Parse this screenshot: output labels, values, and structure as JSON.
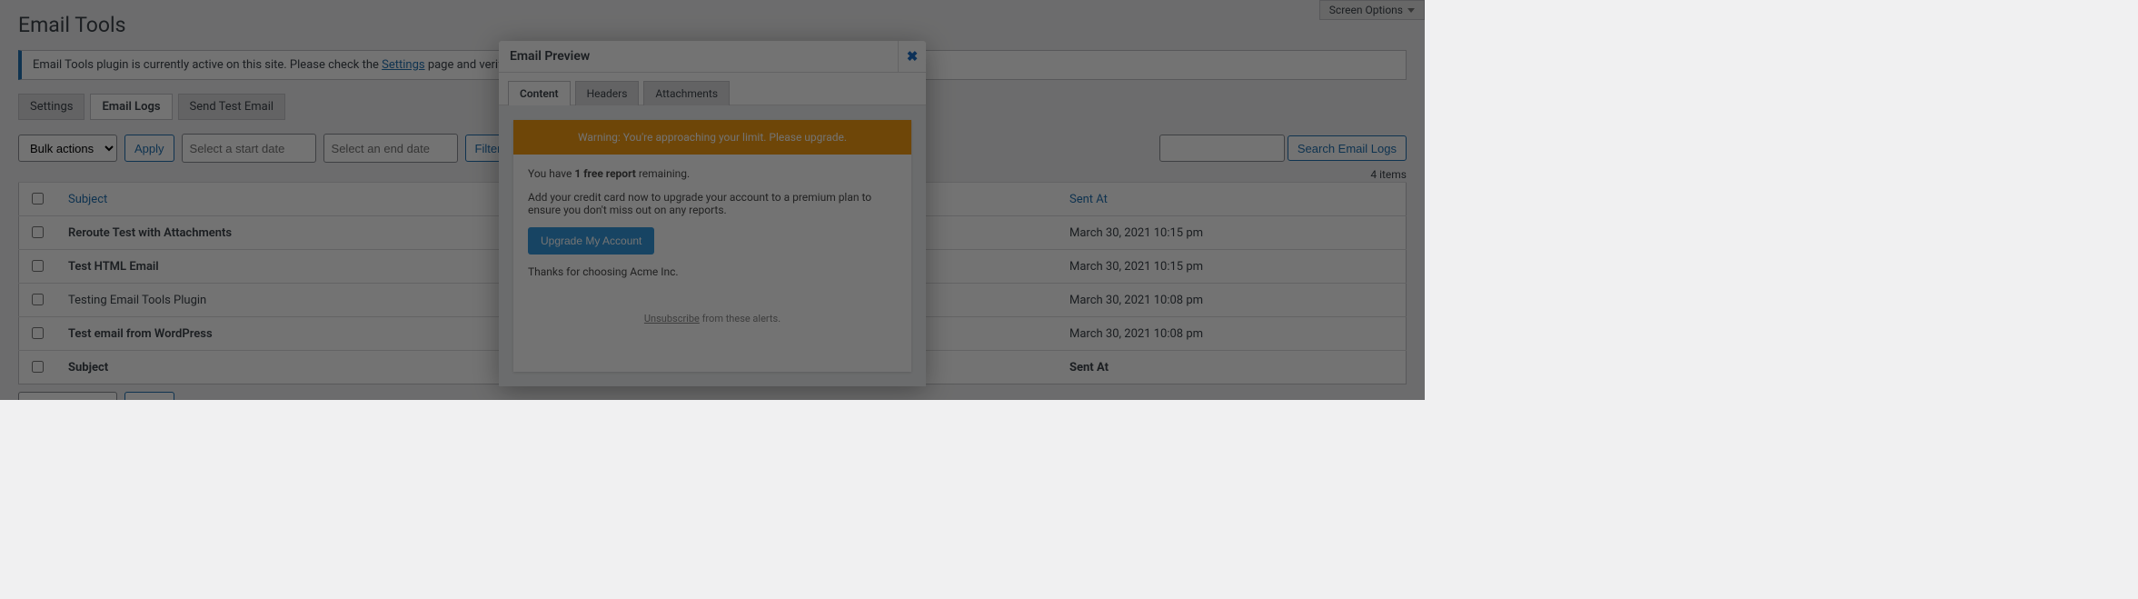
{
  "screen_options": "Screen Options",
  "page_title": "Email Tools",
  "notice": {
    "prefix": "Email Tools plugin is currently active on this site. Please check the ",
    "link": "Settings",
    "suffix": " page and verify if this is intended."
  },
  "subtabs": [
    {
      "label": "Settings",
      "active": false
    },
    {
      "label": "Email Logs",
      "active": true
    },
    {
      "label": "Send Test Email",
      "active": false
    }
  ],
  "bulk": {
    "select_label": "Bulk actions",
    "apply": "Apply"
  },
  "filters": {
    "start_placeholder": "Select a start date",
    "end_placeholder": "Select an end date",
    "button": "Filter"
  },
  "search": {
    "button": "Search Email Logs"
  },
  "items_count": "4 items",
  "table": {
    "cols": {
      "subject": "Subject",
      "sent": "Sent At"
    },
    "rows": [
      {
        "subject": "Reroute Test with Attachments",
        "sent": "March 30, 2021 10:15 pm"
      },
      {
        "subject": "Test HTML Email",
        "sent": "March 30, 2021 10:15 pm"
      },
      {
        "subject": "Testing Email Tools Plugin",
        "sent": "March 30, 2021 10:08 pm"
      },
      {
        "subject": "Test email from WordPress",
        "sent": "March 30, 2021 10:08 pm"
      }
    ]
  },
  "modal": {
    "title": "Email Preview",
    "tabs": [
      {
        "label": "Content",
        "active": true
      },
      {
        "label": "Headers",
        "active": false
      },
      {
        "label": "Attachments",
        "active": false
      }
    ],
    "warning": "Warning: You're approaching your limit. Please upgrade.",
    "line1_pre": "You have ",
    "line1_bold": "1 free report",
    "line1_post": " remaining.",
    "line2": "Add your credit card now to upgrade your account to a premium plan to ensure you don't miss out on any reports.",
    "upgrade": "Upgrade My Account",
    "thanks": "Thanks for choosing Acme Inc.",
    "unsub_link": "Unsubscribe",
    "unsub_post": " from these alerts."
  }
}
